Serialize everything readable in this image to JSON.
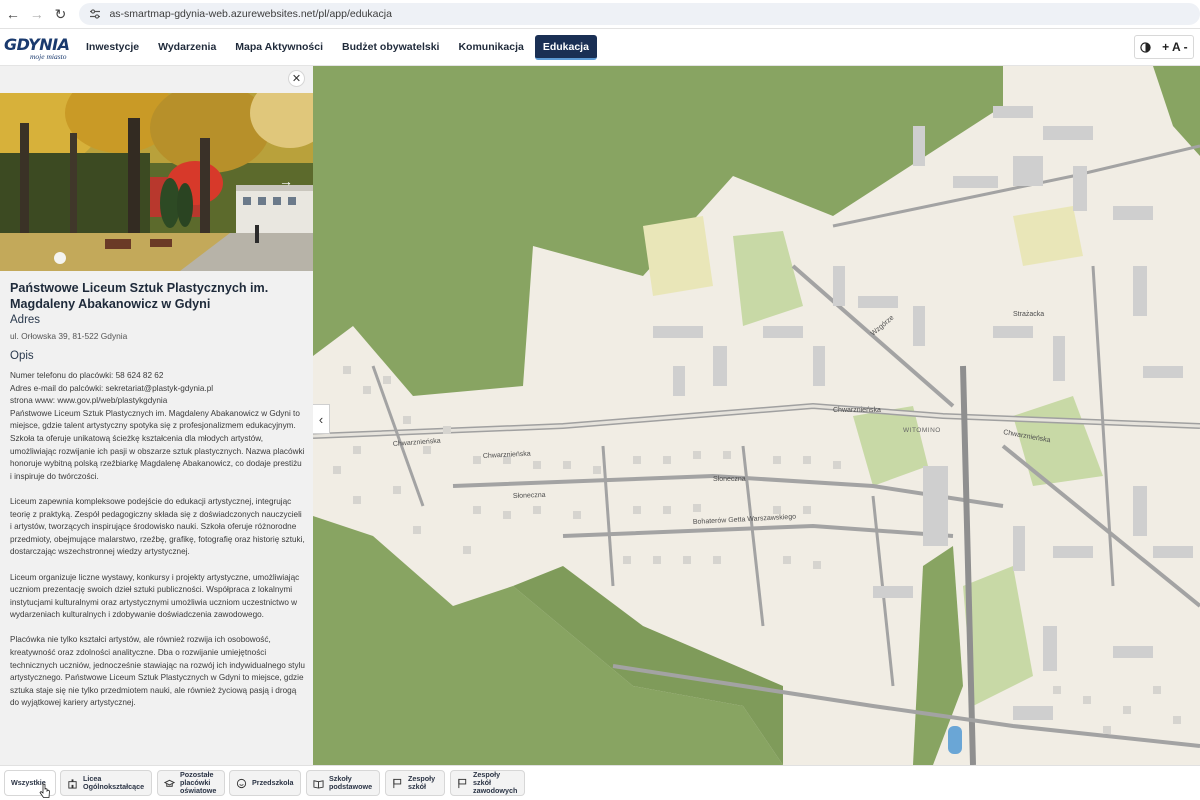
{
  "browser": {
    "url": "as-smartmap-gdynia-web.azurewebsites.net/pl/app/edukacja",
    "back_glyph": "←",
    "forward_glyph": "→",
    "reload_glyph": "↻"
  },
  "header": {
    "logo_text": "GDYNIA",
    "logo_sub": "moje miasto",
    "menu": [
      {
        "label": "Inwestycje"
      },
      {
        "label": "Wydarzenia"
      },
      {
        "label": "Mapa Aktywności"
      },
      {
        "label": "Budżet obywatelski"
      },
      {
        "label": "Komunikacja"
      },
      {
        "label": "Edukacja",
        "active": true
      }
    ],
    "font_controls": "+ A -"
  },
  "sidebar": {
    "close_glyph": "✕",
    "photo_next_glyph": "→",
    "title": "Państwowe Liceum Sztuk Plastycznych im. Magdaleny Abakanowicz w Gdyni",
    "address_heading": "Adres",
    "address": "ul. Orłowska 39, 81-522 Gdynia",
    "description_heading": "Opis",
    "phone_line": "Numer telefonu do placówki: 58 624 82 62",
    "email_line": "Adres e-mail do palcówki: sekretariat@plastyk-gdynia.pl",
    "web_line": "strona www: www.gov.pl/web/plastykgdynia",
    "paragraphs": [
      "Państwowe Liceum Sztuk Plastycznych im. Magdaleny Abakanowicz w Gdyni to miejsce, gdzie talent artystyczny spotyka się z profesjonalizmem edukacyjnym. Szkoła ta oferuje unikatową ścieżkę kształcenia dla młodych artystów, umożliwiając rozwijanie ich pasji w obszarze sztuk plastycznych. Nazwa placówki honoruje wybitną polską rzeźbiarkę Magdalenę Abakanowicz, co dodaje prestiżu i inspiruje do twórczości.",
      "Liceum zapewnia kompleksowe podejście do edukacji artystycznej, integrując teorię z praktyką. Zespół pedagogiczny składa się z doświadczonych nauczycieli i artystów, tworzących inspirujące środowisko nauki. Szkoła oferuje różnorodne przedmioty, obejmujące malarstwo, rzeźbę, grafikę, fotografię oraz historię sztuki, dostarczając wszechstronnej wiedzy artystycznej.",
      "Liceum organizuje liczne wystawy, konkursy i projekty artystyczne, umożliwiając uczniom prezentację swoich dzieł sztuki publiczności. Współpraca z lokalnymi instytucjami kulturalnymi oraz artystycznymi umożliwia uczniom uczestnictwo w wydarzeniach kulturalnych i zdobywanie doświadczenia zawodowego.",
      "Placówka nie tylko kształci artystów, ale również rozwija ich osobowość, kreatywność oraz zdolności analityczne. Dba o rozwijanie umiejętności technicznych uczniów, jednocześnie stawiając na rozwój ich indywidualnego stylu artystycznego. Państwowe Liceum Sztuk Plastycznych w Gdyni to miejsce, gdzie sztuka staje się nie tylko przedmiotem nauki, ale również życiową pasją i drogą do wyjątkowej kariery artystycznej."
    ],
    "collapse_glyph": "‹"
  },
  "map": {
    "district_label": "WITOMINO",
    "street_labels": [
      "Chwarznieńska",
      "Chwarznieńska",
      "Chwarznieńska",
      "Słoneczna",
      "Słoneczna",
      "Bohaterów Getta Warszawskiego",
      "Wzgórze",
      "Strażacka",
      "Chwarznieńska"
    ],
    "colors": {
      "forest": "#88a462",
      "background": "#f1ede4",
      "park": "#c8d9a6",
      "building": "#cfcfcf",
      "road": "#9a9a9a"
    }
  },
  "filters": [
    {
      "label": "Wszystkie",
      "icon": "none",
      "active": true
    },
    {
      "label": "Licea Ogólnokształcące",
      "icon": "school-building-icon"
    },
    {
      "label": "Pozostałe placówki oświatowe",
      "icon": "graduation-cap-icon"
    },
    {
      "label": "Przedszkola",
      "icon": "smile-icon"
    },
    {
      "label": "Szkoły podstawowe",
      "icon": "book-icon"
    },
    {
      "label": "Zespoły szkół",
      "icon": "flag-icon"
    },
    {
      "label": "Zespoły szkół zawodowych",
      "icon": "flag-icon"
    }
  ]
}
